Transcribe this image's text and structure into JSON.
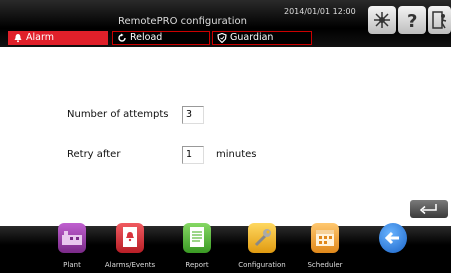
{
  "header": {
    "title": "RemotePRO configuration",
    "datetime": "2014/01/01  12:00",
    "tabs": [
      {
        "label": "Alarm",
        "icon": "bell-icon"
      },
      {
        "label": "Reload",
        "icon": "reload-icon"
      },
      {
        "label": "Guardian",
        "icon": "shield-icon"
      }
    ],
    "icons": [
      "network-icon",
      "help-icon",
      "exit-icon"
    ]
  },
  "form": {
    "attempts_label": "Number of attempts",
    "attempts_value": "3",
    "retry_label": "Retry after",
    "retry_value": "1",
    "retry_unit": "minutes"
  },
  "nav": {
    "items": [
      {
        "label": "Plant",
        "icon": "plant-icon",
        "color": "#9b3aa8"
      },
      {
        "label": "Alarms/Events",
        "icon": "alarm-events-icon",
        "color": "#d8323c"
      },
      {
        "label": "Report",
        "icon": "report-icon",
        "color": "#5bbb3a"
      },
      {
        "label": "Configuration",
        "icon": "wrench-icon",
        "color": "#f2b620"
      },
      {
        "label": "Scheduler",
        "icon": "calendar-icon",
        "color": "#f0a030"
      },
      {
        "label": "",
        "icon": "back-arrow-icon",
        "color": "#2a7fdc"
      }
    ]
  },
  "colors": {
    "accent": "#e0202a",
    "bar": "#000000"
  }
}
